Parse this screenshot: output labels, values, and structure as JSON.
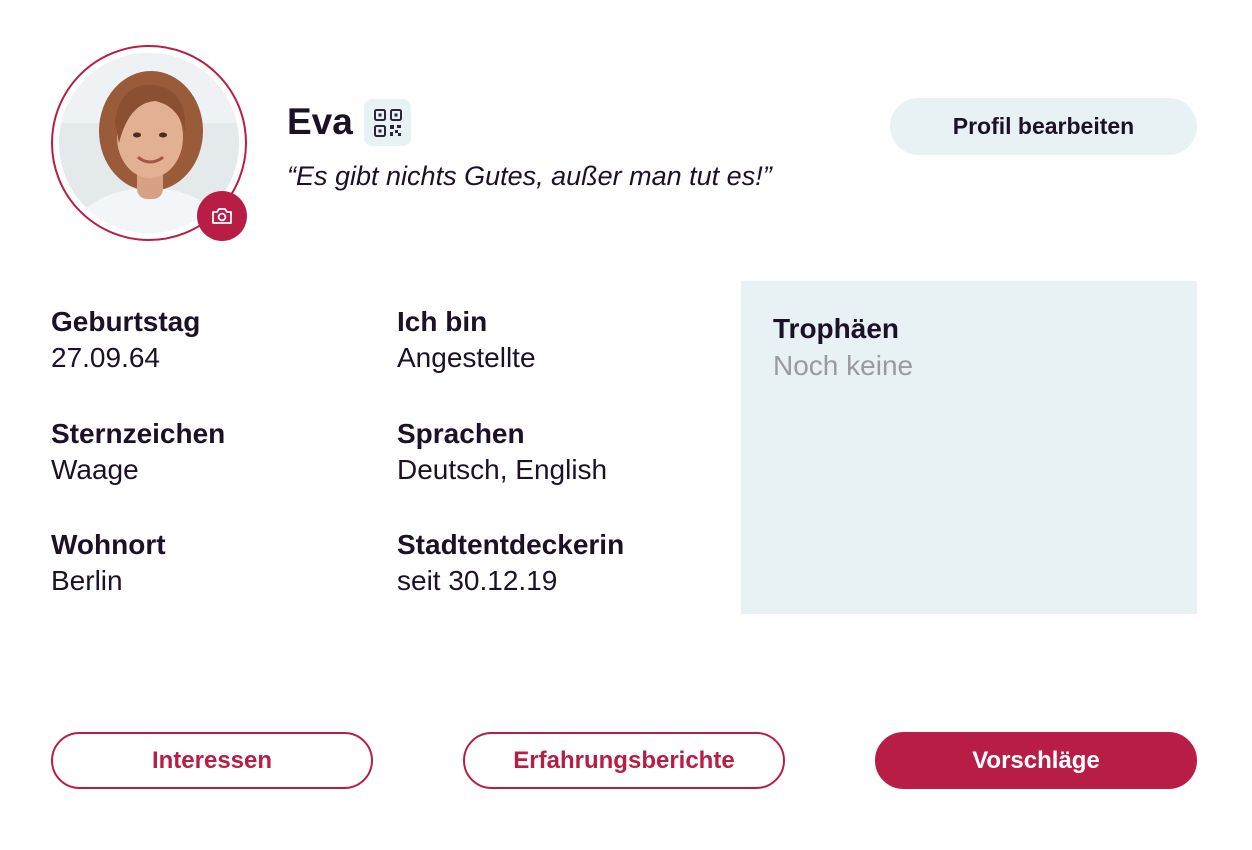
{
  "profile": {
    "name": "Eva",
    "quote": "“Es gibt nichts Gutes, außer man tut es!”",
    "avatar_icon": "profile-photo",
    "camera_icon": "camera-icon",
    "qr_icon": "qr-code-icon"
  },
  "actions": {
    "edit_label": "Profil bearbeiten"
  },
  "details": {
    "birthday": {
      "label": "Geburtstag",
      "value": "27.09.64"
    },
    "zodiac": {
      "label": "Sternzeichen",
      "value": "Waage"
    },
    "residence": {
      "label": "Wohnort",
      "value": "Berlin"
    },
    "occupation": {
      "label": "Ich bin",
      "value": "Angestellte"
    },
    "languages": {
      "label": "Sprachen",
      "value": "Deutsch, English"
    },
    "explorer": {
      "label": "Stadtentdeckerin",
      "value": "seit 30.12.19"
    }
  },
  "trophies": {
    "label": "Trophäen",
    "value": "Noch keine"
  },
  "tabs": {
    "interests": "Interessen",
    "reports": "Erfahrungsberichte",
    "suggestions": "Vorschläge"
  },
  "colors": {
    "accent": "#b81e45",
    "panel": "#e8f1f4",
    "text": "#1d1128",
    "muted": "#9b9aa1"
  }
}
